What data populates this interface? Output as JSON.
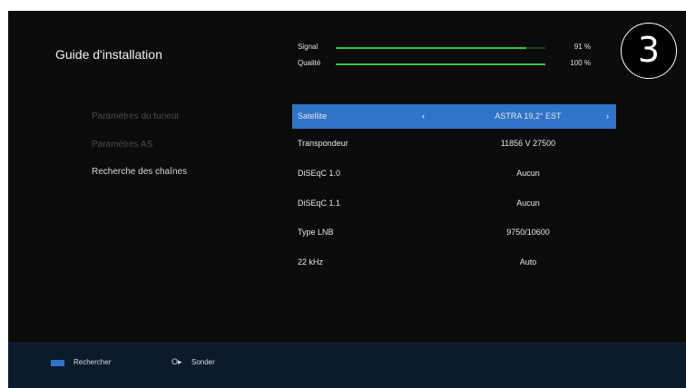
{
  "title": "Guide d'installation",
  "sidebar": {
    "items": [
      {
        "label": "Paramètres du tuneur",
        "active": false
      },
      {
        "label": "Paramètres AS",
        "active": false
      },
      {
        "label": "Recherche des chaînes",
        "active": true
      }
    ]
  },
  "meters": {
    "signal": {
      "label": "Signal",
      "value_text": "91 %",
      "level": 0.91
    },
    "quality": {
      "label": "Qualité",
      "value_text": "100 %",
      "level": 1.0
    },
    "bar_color": "#34c23f"
  },
  "settings": [
    {
      "label": "Satellite",
      "value": "ASTRA 19,2° EST",
      "selected": true
    },
    {
      "label": "Transpondeur",
      "value": "11856 V 27500",
      "selected": false
    },
    {
      "label": "DiSEqC 1.0",
      "value": "Aucun",
      "selected": false
    },
    {
      "label": "DiSEqC 1.1",
      "value": "Aucun",
      "selected": false
    },
    {
      "label": "Type LNB",
      "value": "9750/10600",
      "selected": false
    },
    {
      "label": "22 kHz",
      "value": "Auto",
      "selected": false
    }
  ],
  "arrows": {
    "left": "‹",
    "right": "›"
  },
  "footer": {
    "blue_key_label": "Rechercher",
    "ok_key_label": "Sonder"
  },
  "step_badge": "3",
  "colors": {
    "selection": "#2f74c8",
    "footer_bg": "#0a1b2b",
    "screen_bg": "#0b0b0b"
  }
}
